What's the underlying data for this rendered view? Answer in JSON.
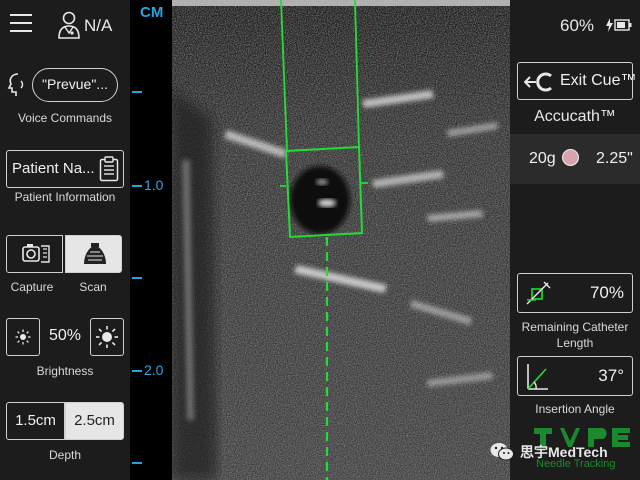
{
  "header": {
    "user_name": "N/A"
  },
  "voice": {
    "bubble_label": "\"Prevue\"...",
    "caption": "Voice Commands"
  },
  "patient": {
    "label": "Patient Na...",
    "caption": "Patient Information"
  },
  "mode": {
    "capture_caption": "Capture",
    "scan_caption": "Scan",
    "selected": "Scan"
  },
  "brightness": {
    "value": "50%",
    "caption": "Brightness"
  },
  "depth": {
    "option_1": "1.5cm",
    "option_2": "2.5cm",
    "selected": "2.5cm",
    "caption": "Depth"
  },
  "scale": {
    "unit": "CM",
    "tick_1": "1.0",
    "tick_2": "2.0"
  },
  "status": {
    "battery": "60%"
  },
  "right": {
    "exit_label": "Exit Cue™",
    "product_name": "Accucath™",
    "gauge": "20g",
    "length": "2.25\"",
    "remaining_value": "70%",
    "remaining_caption": "Remaining Catheter Length",
    "angle_value": "37°",
    "angle_caption": "Insertion Angle"
  },
  "watermark": {
    "text": "思宇MedTech",
    "sub": "Needle Tracking"
  },
  "colors": {
    "accent_blue": "#29a3e0",
    "overlay_green": "#22dd33",
    "gauge_pink": "#d8a3ad"
  }
}
